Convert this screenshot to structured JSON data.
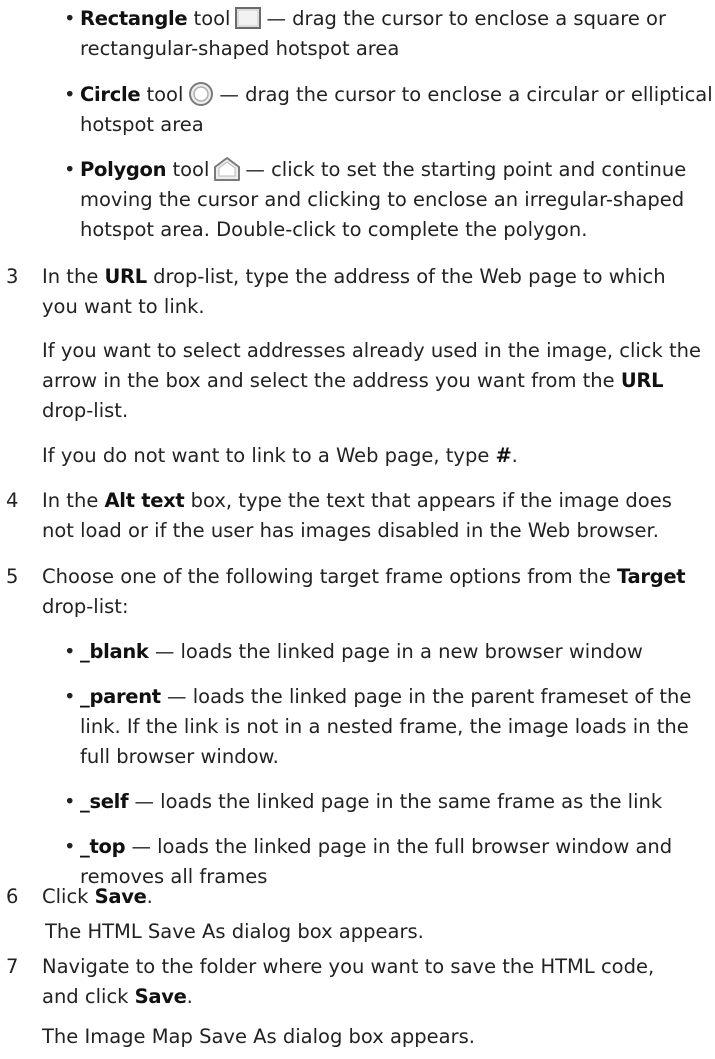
{
  "tools": {
    "rectangle": {
      "name": "Rectangle",
      "pre": "tool",
      "line1": "— drag the cursor to enclose a square or",
      "line2": "rectangular-shaped hotspot area",
      "icon": "rectangle-tool-icon"
    },
    "circle": {
      "name": "Circle",
      "pre": "tool",
      "line1": "— drag the cursor to enclose a circular or elliptical",
      "line2": "hotspot area",
      "icon": "circle-tool-icon"
    },
    "polygon": {
      "name": "Polygon",
      "pre": "tool",
      "line1": "— click to set the starting point and continue",
      "line2": "moving the cursor and clicking to enclose an irregular-shaped",
      "line3": "hotspot area. Double-click to complete the polygon.",
      "icon": "polygon-tool-icon"
    }
  },
  "steps": {
    "s3": {
      "num": "3",
      "a": "In the",
      "bold": "URL",
      "b": "drop-list, type the address of the Web page to which",
      "line2": "you want to link.",
      "para1_line1": "If you want to select addresses already used in the image, click the",
      "para1_line2_a": "arrow in the box and select the address you want from the",
      "para1_line2_bold": "URL",
      "para1_line3": "drop-list.",
      "para2_a": "If you do not want to link to a Web page, type",
      "para2_bold": "#",
      "para2_b": "."
    },
    "s4": {
      "num": "4",
      "a": "In the",
      "bold": "Alt text",
      "b": "box, type the text that appears if the image does",
      "line2": "not load or if the user has images disabled in the Web browser."
    },
    "s5": {
      "num": "5",
      "a": "Choose one of the following target frame options from the",
      "bold": "Target",
      "line2": "drop-list:"
    },
    "s6": {
      "num": "6",
      "a": "Click",
      "bold": "Save",
      "b": ".",
      "result": "The HTML Save As dialog box appears."
    },
    "s7": {
      "num": "7",
      "line1": "Navigate to the folder where you want to save the HTML code,",
      "line2_a": "and click",
      "line2_bold": "Save",
      "line2_b": ".",
      "result": "The Image Map Save As dialog box appears."
    }
  },
  "targets": {
    "blank": {
      "name": "_blank",
      "line1": "— loads the linked page in a new browser window"
    },
    "parent": {
      "name": "_parent",
      "line1": "— loads the linked page in the parent frameset of the",
      "line2": "link. If the link is not in a nested frame, the image loads in the",
      "line3": "full browser window."
    },
    "self": {
      "name": "_self",
      "line1": "— loads the linked page in the same frame as the link"
    },
    "top": {
      "name": "_top",
      "line1": "— loads the linked page in the full browser window and",
      "line2": "removes all frames"
    }
  },
  "bullet": "•"
}
